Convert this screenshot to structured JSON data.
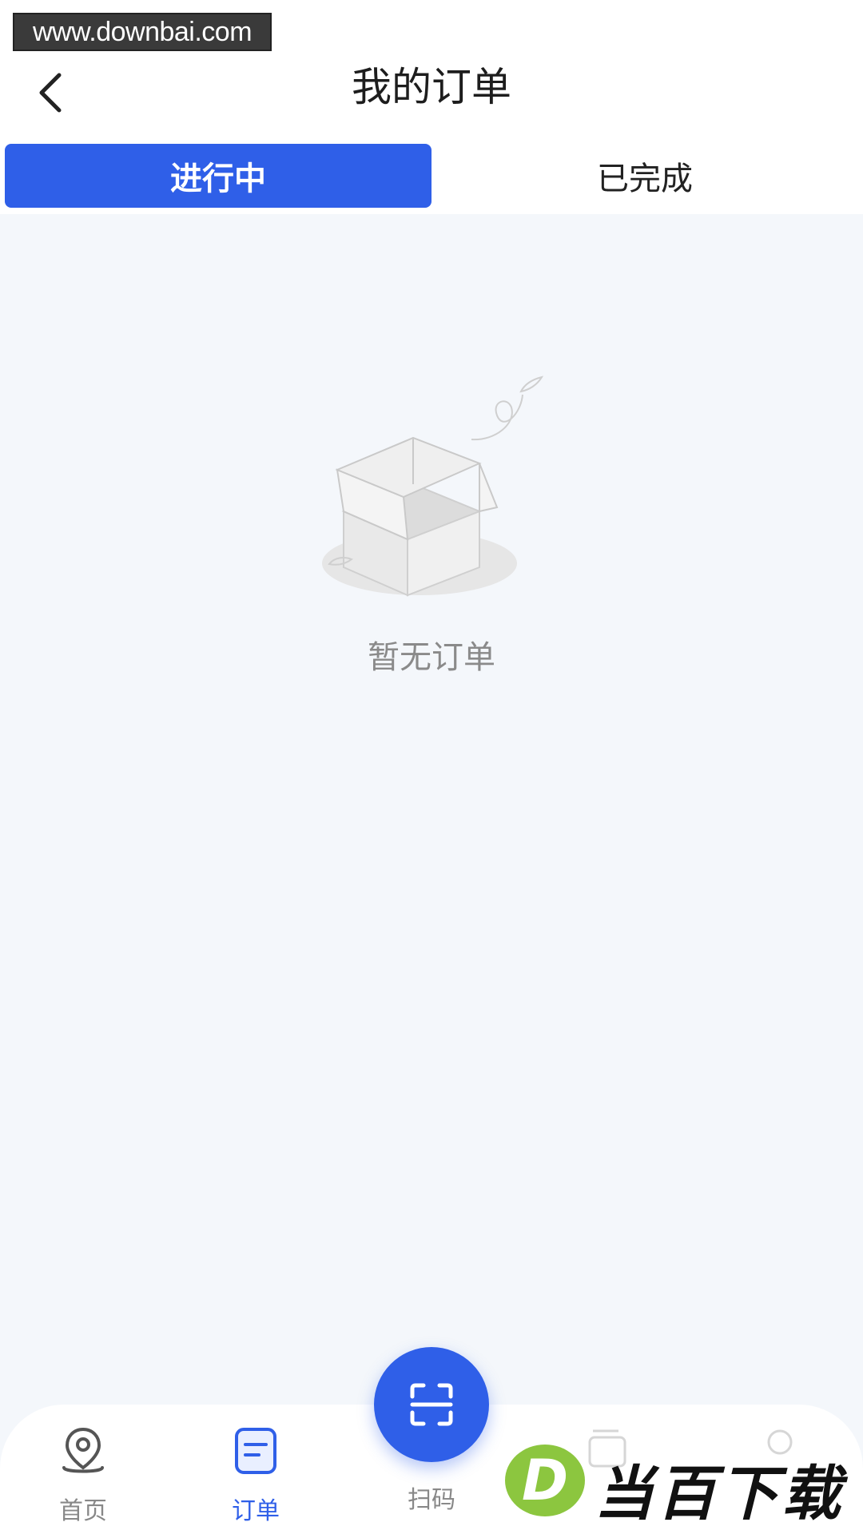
{
  "watermark_top": "www.downbai.com",
  "header": {
    "title": "我的订单",
    "back_icon": "chevron-left-icon"
  },
  "tabs": [
    {
      "label": "进行中",
      "active": true
    },
    {
      "label": "已完成",
      "active": false
    }
  ],
  "empty_state": {
    "illustration": "empty-box-icon",
    "text": "暂无订单"
  },
  "tabbar": {
    "items": [
      {
        "label": "首页",
        "icon": "location-pin-icon",
        "active": false
      },
      {
        "label": "订单",
        "icon": "order-list-icon",
        "active": true
      },
      {
        "label": "扫码",
        "icon": "scan-icon",
        "active": false
      },
      {
        "label": "",
        "icon": "wallet-icon",
        "active": false
      },
      {
        "label": "",
        "icon": "user-icon",
        "active": false
      }
    ]
  },
  "colors": {
    "accent": "#2f5fe8",
    "background": "#f4f7fb",
    "inactive_text": "#888888"
  },
  "watermark_logo": {
    "letter": "D",
    "text": "当百下载"
  }
}
